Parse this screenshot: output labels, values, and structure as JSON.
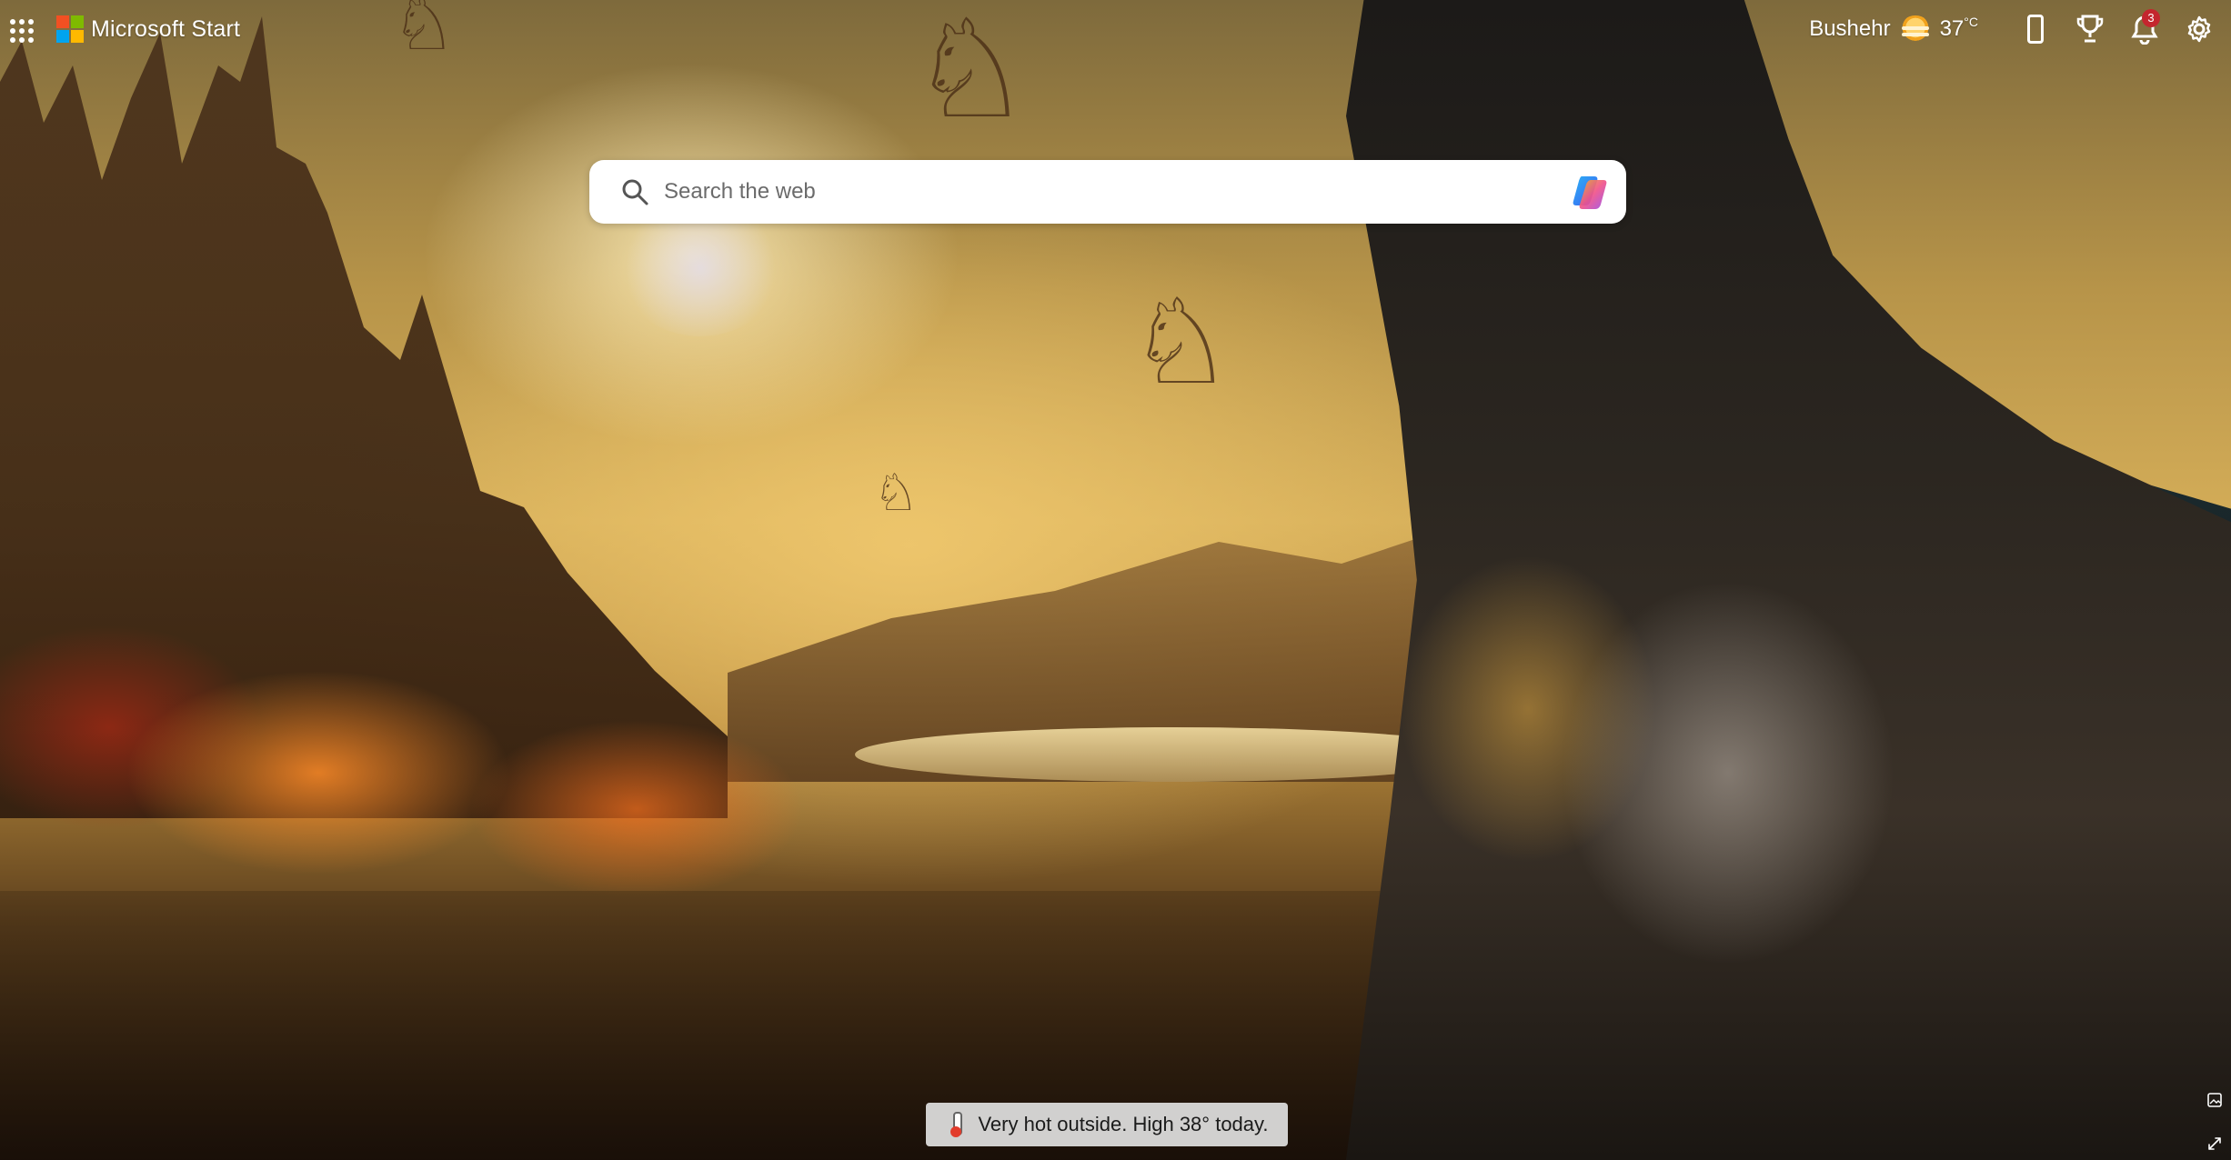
{
  "brand": {
    "name": "Microsoft Start",
    "logo_colors": [
      "#f25022",
      "#7fba00",
      "#00a4ef",
      "#ffb900"
    ]
  },
  "topbar": {
    "apps_icon": "app-launcher-icon",
    "weather": {
      "city": "Bushehr",
      "temperature": "37",
      "unit": "°C",
      "icon": "sunny-haze-icon"
    },
    "notifications_count": "3",
    "tools": [
      "phone-icon",
      "rewards-trophy-icon",
      "bell-icon",
      "gear-icon"
    ]
  },
  "search": {
    "placeholder": "Search the web",
    "value": "",
    "icon": "search-icon",
    "assistant_icon": "copilot-icon"
  },
  "toast": {
    "text": "Very hot outside. High 38° today.",
    "icon": "thermometer-icon"
  },
  "corner_controls": [
    "image-info-icon",
    "expand-icon"
  ],
  "colors": {
    "badge": "#c4262e",
    "toast_bg": "#e1e1e1"
  }
}
